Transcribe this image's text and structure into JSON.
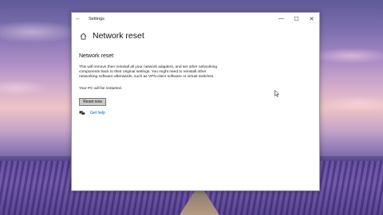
{
  "window": {
    "title": "Settings",
    "controls": {
      "minimize": "—",
      "maximize": "☐",
      "close": "✕"
    },
    "back_glyph": "←"
  },
  "page": {
    "title": "Network reset",
    "icon": "home-icon"
  },
  "content": {
    "section_title": "Network reset",
    "description": "This will remove then reinstall all your network adapters, and set other networking components back to their original settings. You might need to reinstall other networking software afterwards, such as VPN client software or virtual switches.",
    "restart_note": "Your PC will be restarted.",
    "reset_button": "Reset now",
    "help_link": "Get help",
    "help_icon": "chat-icon"
  },
  "colors": {
    "link": "#0063b1",
    "button_bg": "#cccccc"
  }
}
